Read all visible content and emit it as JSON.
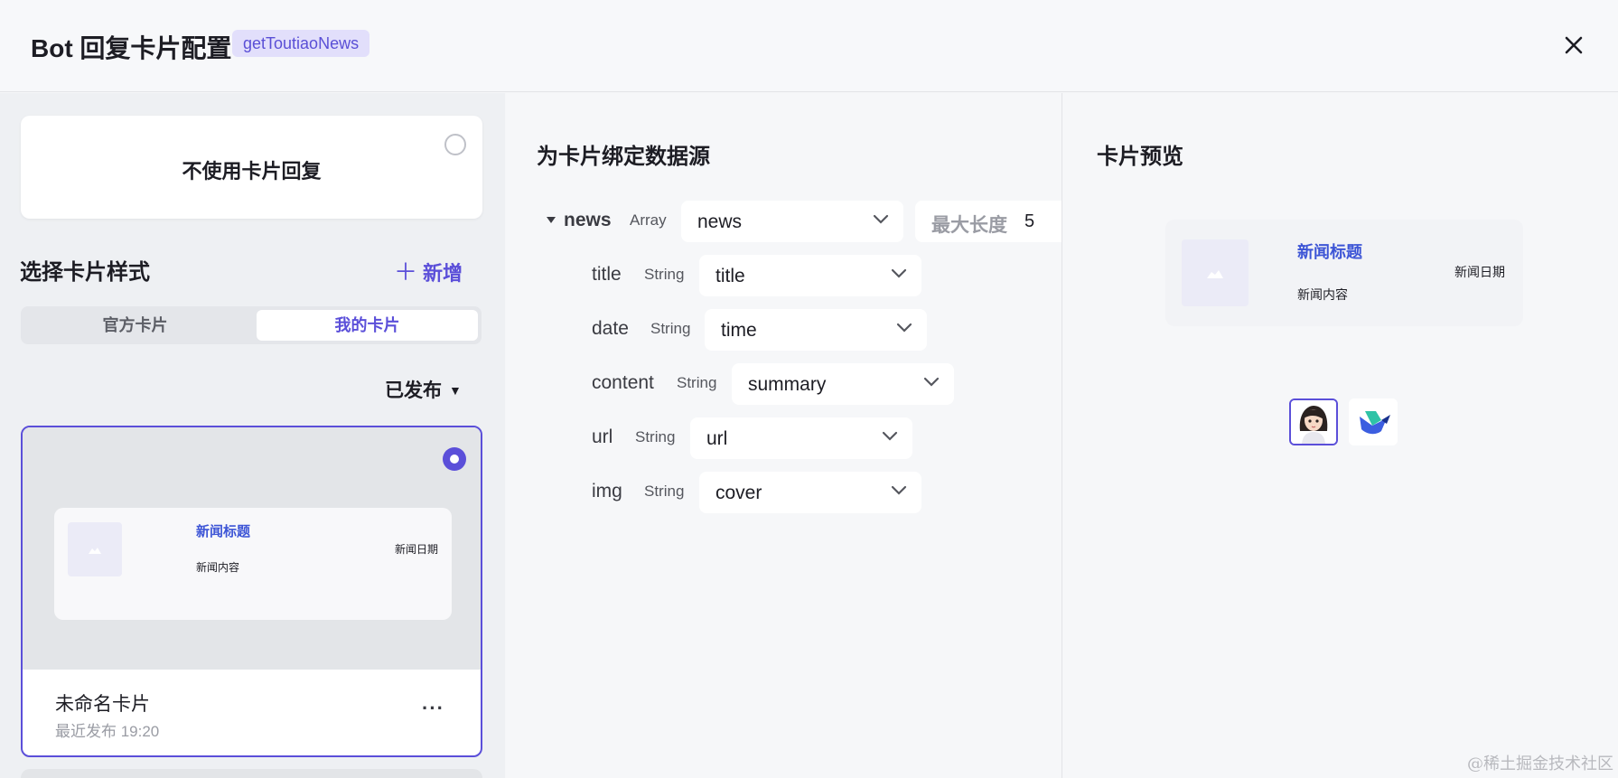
{
  "header": {
    "title": "Bot 回复卡片配置",
    "tag": "getToutiaoNews",
    "close_icon": "close-icon"
  },
  "left": {
    "no_card_label": "不使用卡片回复",
    "section_title": "选择卡片样式",
    "add_label": "新增",
    "add_icon": "＋",
    "tabs": [
      {
        "label": "官方卡片",
        "active": false
      },
      {
        "label": "我的卡片",
        "active": true
      }
    ],
    "filter_label": "已发布",
    "card": {
      "preview": {
        "title": "新闻标题",
        "content": "新闻内容",
        "date": "新闻日期"
      },
      "name": "未命名卡片",
      "meta": "最近发布 19:20",
      "more": "···",
      "selected": true
    }
  },
  "middle": {
    "title": "为卡片绑定数据源",
    "root": {
      "name": "news",
      "type": "Array",
      "value": "news",
      "max_label": "最大长度",
      "max_value": "5"
    },
    "fields": [
      {
        "name": "title",
        "type": "String",
        "value": "title"
      },
      {
        "name": "date",
        "type": "String",
        "value": "time"
      },
      {
        "name": "content",
        "type": "String",
        "value": "summary"
      },
      {
        "name": "url",
        "type": "String",
        "value": "url"
      },
      {
        "name": "img",
        "type": "String",
        "value": "cover"
      }
    ]
  },
  "right": {
    "title": "卡片预览",
    "preview": {
      "title": "新闻标题",
      "content": "新闻内容",
      "date": "新闻日期"
    },
    "platforms": [
      "avatar-icon",
      "feishu-logo-icon"
    ]
  },
  "watermark": "@稀土掘金技术社区",
  "colors": {
    "accent": "#5b4fd9",
    "title_blue": "#3d55d6",
    "tag_bg": "#e2dffb"
  }
}
